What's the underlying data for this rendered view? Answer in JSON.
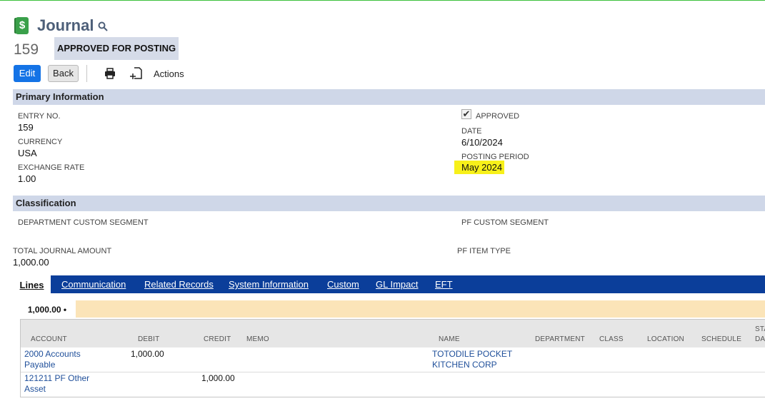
{
  "header": {
    "title": "Journal",
    "icon": "dollar-journal-icon",
    "record_number": "159",
    "status": "APPROVED FOR POSTING"
  },
  "toolbar": {
    "edit_label": "Edit",
    "back_label": "Back",
    "actions_label": "Actions"
  },
  "primary": {
    "section_title": "Primary Information",
    "entry_no_label": "ENTRY NO.",
    "entry_no": "159",
    "currency_label": "CURRENCY",
    "currency": "USA",
    "exchange_rate_label": "EXCHANGE RATE",
    "exchange_rate": "1.00",
    "approved_label": "APPROVED",
    "approved_checked": true,
    "date_label": "DATE",
    "date": "6/10/2024",
    "posting_period_label": "POSTING PERIOD",
    "posting_period": "May 2024"
  },
  "classification": {
    "section_title": "Classification",
    "department_label": "DEPARTMENT CUSTOM SEGMENT",
    "pf_segment_label": "PF CUSTOM SEGMENT",
    "total_label": "TOTAL JOURNAL AMOUNT",
    "total": "1,000.00",
    "pf_item_type_label": "PF ITEM TYPE"
  },
  "tabs": [
    {
      "label": "Lines",
      "active": true
    },
    {
      "label": "Communication"
    },
    {
      "label": "Related Records"
    },
    {
      "label": "System Information"
    },
    {
      "label": "Custom"
    },
    {
      "label": "GL Impact"
    },
    {
      "label": "EFT"
    }
  ],
  "subtab": {
    "label": "1,000.00 •"
  },
  "lines_table": {
    "columns": [
      "ACCOUNT",
      "DEBIT",
      "CREDIT",
      "MEMO",
      "NAME",
      "DEPARTMENT",
      "CLASS",
      "LOCATION",
      "SCHEDULE",
      "STA",
      "DA"
    ],
    "rows": [
      {
        "account_1": "2000 Accounts",
        "account_2": "Payable",
        "debit": "1,000.00",
        "credit": "",
        "memo": "",
        "name_1": "TOTODILE POCKET",
        "name_2": "KITCHEN CORP"
      },
      {
        "account_1": "121211 PF Other",
        "account_2": "Asset",
        "debit": "",
        "credit": "1,000.00",
        "memo": "",
        "name_1": "",
        "name_2": ""
      }
    ]
  },
  "colors": {
    "accent_blue": "#1473e6",
    "tab_bar": "#0b3e9a",
    "section_header": "#cfd7e8",
    "highlight": "#f7f01a"
  }
}
